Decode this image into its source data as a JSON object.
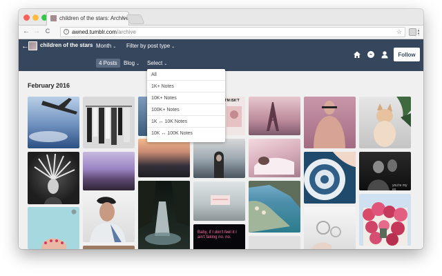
{
  "browser": {
    "tab_title": "children of the stars: Archive",
    "tab_close": "×",
    "url_host": "awned.tumblr.com",
    "url_path": "/archive",
    "nav_back": "←",
    "nav_forward": "→",
    "nav_reload": "C",
    "lock_glyph": "i",
    "star_glyph": "☆",
    "colors": {
      "close": "#fc605b",
      "minimize": "#fdbc40",
      "maximize": "#34c84a"
    }
  },
  "header": {
    "back_glyph": "←",
    "blog_title": "children of the stars",
    "month_label": "Month",
    "filter_label": "Filter by post type",
    "posts_badge": "4 Posts",
    "blog_label": "Blog",
    "select_label": "Select",
    "caret": "⌄",
    "follow_label": "Follow",
    "background_color": "#36465d"
  },
  "archive": {
    "month_heading": "February 2016"
  },
  "dropdown": {
    "options": [
      "All",
      "1K+ Notes",
      "10K+ Notes",
      "100K+ Notes",
      "1K ↔ 10K Notes",
      "10K ↔ 100K Notes"
    ]
  },
  "tiles": {
    "poster_text": "I'M ISK'T",
    "neon_text": "Baby, if I don't feel it I ain't faking no. no.",
    "youre_text": "you're my ex"
  }
}
